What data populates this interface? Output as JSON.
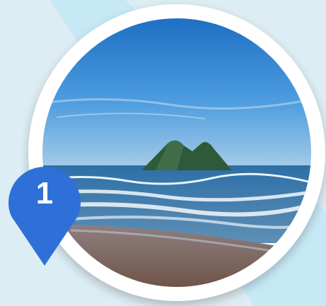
{
  "marker": {
    "number": "1",
    "color": "#2f6fd8"
  },
  "photo": {
    "subject-icon": "beach-with-twin-peak-island",
    "sky_color": "#3f93d8",
    "sea_color": "#3a78b0",
    "sand_color": "#8c7062"
  },
  "theme": {
    "background": "#ddedf4",
    "stripe": "#c7e9f6",
    "frame": "#ffffff"
  }
}
